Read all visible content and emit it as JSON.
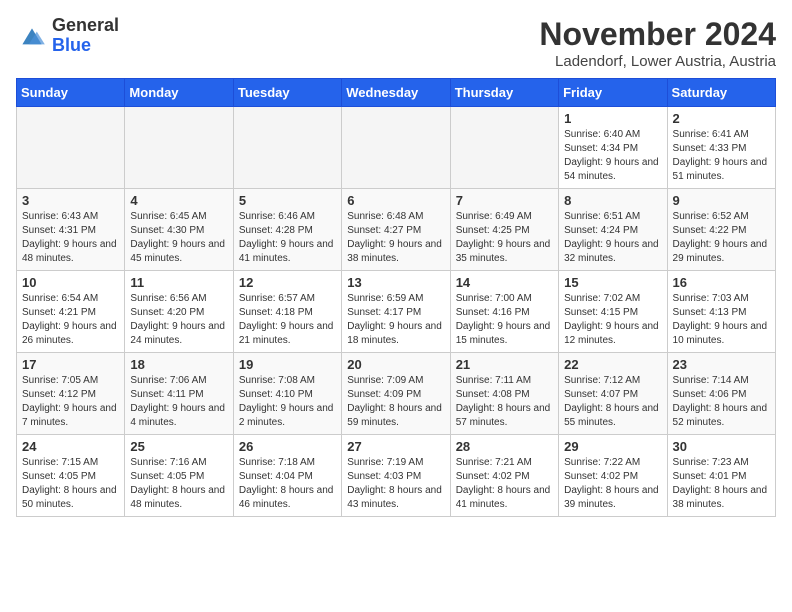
{
  "logo": {
    "text_general": "General",
    "text_blue": "Blue"
  },
  "header": {
    "month": "November 2024",
    "location": "Ladendorf, Lower Austria, Austria"
  },
  "weekdays": [
    "Sunday",
    "Monday",
    "Tuesday",
    "Wednesday",
    "Thursday",
    "Friday",
    "Saturday"
  ],
  "weeks": [
    [
      {
        "day": "",
        "empty": true
      },
      {
        "day": "",
        "empty": true
      },
      {
        "day": "",
        "empty": true
      },
      {
        "day": "",
        "empty": true
      },
      {
        "day": "",
        "empty": true
      },
      {
        "day": "1",
        "sunrise": "6:40 AM",
        "sunset": "4:34 PM",
        "daylight": "9 hours and 54 minutes."
      },
      {
        "day": "2",
        "sunrise": "6:41 AM",
        "sunset": "4:33 PM",
        "daylight": "9 hours and 51 minutes."
      }
    ],
    [
      {
        "day": "3",
        "sunrise": "6:43 AM",
        "sunset": "4:31 PM",
        "daylight": "9 hours and 48 minutes."
      },
      {
        "day": "4",
        "sunrise": "6:45 AM",
        "sunset": "4:30 PM",
        "daylight": "9 hours and 45 minutes."
      },
      {
        "day": "5",
        "sunrise": "6:46 AM",
        "sunset": "4:28 PM",
        "daylight": "9 hours and 41 minutes."
      },
      {
        "day": "6",
        "sunrise": "6:48 AM",
        "sunset": "4:27 PM",
        "daylight": "9 hours and 38 minutes."
      },
      {
        "day": "7",
        "sunrise": "6:49 AM",
        "sunset": "4:25 PM",
        "daylight": "9 hours and 35 minutes."
      },
      {
        "day": "8",
        "sunrise": "6:51 AM",
        "sunset": "4:24 PM",
        "daylight": "9 hours and 32 minutes."
      },
      {
        "day": "9",
        "sunrise": "6:52 AM",
        "sunset": "4:22 PM",
        "daylight": "9 hours and 29 minutes."
      }
    ],
    [
      {
        "day": "10",
        "sunrise": "6:54 AM",
        "sunset": "4:21 PM",
        "daylight": "9 hours and 26 minutes."
      },
      {
        "day": "11",
        "sunrise": "6:56 AM",
        "sunset": "4:20 PM",
        "daylight": "9 hours and 24 minutes."
      },
      {
        "day": "12",
        "sunrise": "6:57 AM",
        "sunset": "4:18 PM",
        "daylight": "9 hours and 21 minutes."
      },
      {
        "day": "13",
        "sunrise": "6:59 AM",
        "sunset": "4:17 PM",
        "daylight": "9 hours and 18 minutes."
      },
      {
        "day": "14",
        "sunrise": "7:00 AM",
        "sunset": "4:16 PM",
        "daylight": "9 hours and 15 minutes."
      },
      {
        "day": "15",
        "sunrise": "7:02 AM",
        "sunset": "4:15 PM",
        "daylight": "9 hours and 12 minutes."
      },
      {
        "day": "16",
        "sunrise": "7:03 AM",
        "sunset": "4:13 PM",
        "daylight": "9 hours and 10 minutes."
      }
    ],
    [
      {
        "day": "17",
        "sunrise": "7:05 AM",
        "sunset": "4:12 PM",
        "daylight": "9 hours and 7 minutes."
      },
      {
        "day": "18",
        "sunrise": "7:06 AM",
        "sunset": "4:11 PM",
        "daylight": "9 hours and 4 minutes."
      },
      {
        "day": "19",
        "sunrise": "7:08 AM",
        "sunset": "4:10 PM",
        "daylight": "9 hours and 2 minutes."
      },
      {
        "day": "20",
        "sunrise": "7:09 AM",
        "sunset": "4:09 PM",
        "daylight": "8 hours and 59 minutes."
      },
      {
        "day": "21",
        "sunrise": "7:11 AM",
        "sunset": "4:08 PM",
        "daylight": "8 hours and 57 minutes."
      },
      {
        "day": "22",
        "sunrise": "7:12 AM",
        "sunset": "4:07 PM",
        "daylight": "8 hours and 55 minutes."
      },
      {
        "day": "23",
        "sunrise": "7:14 AM",
        "sunset": "4:06 PM",
        "daylight": "8 hours and 52 minutes."
      }
    ],
    [
      {
        "day": "24",
        "sunrise": "7:15 AM",
        "sunset": "4:05 PM",
        "daylight": "8 hours and 50 minutes."
      },
      {
        "day": "25",
        "sunrise": "7:16 AM",
        "sunset": "4:05 PM",
        "daylight": "8 hours and 48 minutes."
      },
      {
        "day": "26",
        "sunrise": "7:18 AM",
        "sunset": "4:04 PM",
        "daylight": "8 hours and 46 minutes."
      },
      {
        "day": "27",
        "sunrise": "7:19 AM",
        "sunset": "4:03 PM",
        "daylight": "8 hours and 43 minutes."
      },
      {
        "day": "28",
        "sunrise": "7:21 AM",
        "sunset": "4:02 PM",
        "daylight": "8 hours and 41 minutes."
      },
      {
        "day": "29",
        "sunrise": "7:22 AM",
        "sunset": "4:02 PM",
        "daylight": "8 hours and 39 minutes."
      },
      {
        "day": "30",
        "sunrise": "7:23 AM",
        "sunset": "4:01 PM",
        "daylight": "8 hours and 38 minutes."
      }
    ]
  ]
}
